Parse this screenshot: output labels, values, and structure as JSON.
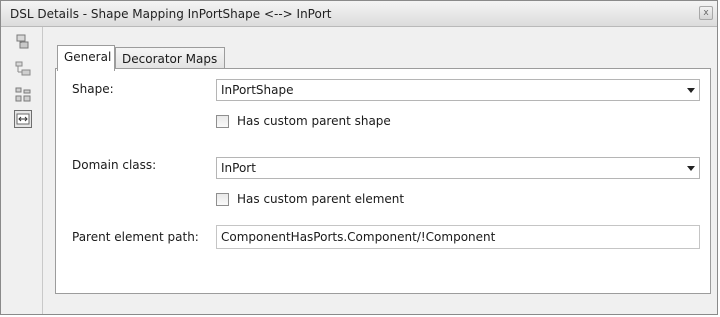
{
  "window": {
    "title": "DSL Details - Shape Mapping InPortShape <--> InPort",
    "close_glyph": "x"
  },
  "toolbar": {
    "items": [
      {
        "icon": "element-tree-icon"
      },
      {
        "icon": "child-elements-icon"
      },
      {
        "icon": "hierarchy-icon"
      },
      {
        "icon": "shape-map-icon",
        "selected": true
      }
    ]
  },
  "tabs": [
    {
      "label": "General",
      "active": true
    },
    {
      "label": "Decorator Maps",
      "active": false
    }
  ],
  "form": {
    "shape_label": "Shape:",
    "shape_value": "InPortShape",
    "custom_parent_shape_label": "Has custom parent shape",
    "domain_class_label": "Domain class:",
    "domain_class_value": "InPort",
    "custom_parent_element_label": "Has custom parent element",
    "parent_path_label": "Parent element path:",
    "parent_path_value": "ComponentHasPorts.Component/!Component"
  }
}
